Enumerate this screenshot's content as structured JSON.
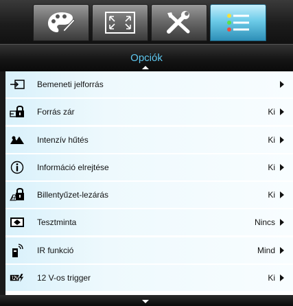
{
  "tabs": [
    {
      "icon": "palette-icon",
      "active": false
    },
    {
      "icon": "screen-resize-icon",
      "active": false
    },
    {
      "icon": "tools-icon",
      "active": false
    },
    {
      "icon": "options-list-icon",
      "active": true
    }
  ],
  "header": {
    "title": "Opciók"
  },
  "menu": {
    "items": [
      {
        "icon": "input-source-icon",
        "label": "Bemeneti jelforrás",
        "value": ""
      },
      {
        "icon": "source-lock-icon",
        "label": "Forrás zár",
        "value": "Ki"
      },
      {
        "icon": "high-cooling-icon",
        "label": "Intenzív hűtés",
        "value": "Ki"
      },
      {
        "icon": "info-icon",
        "label": "Információ elrejtése",
        "value": "Ki"
      },
      {
        "icon": "keypad-lock-icon",
        "label": "Billentyűzet-lezárás",
        "value": "Ki"
      },
      {
        "icon": "test-pattern-icon",
        "label": "Tesztminta",
        "value": "Nincs"
      },
      {
        "icon": "ir-remote-icon",
        "label": "IR funkció",
        "value": "Mind"
      },
      {
        "icon": "trigger-12v-icon",
        "label": "12 V-os trigger",
        "value": "Ki"
      }
    ]
  },
  "colors": {
    "accent": "#5fc8f0",
    "active_tab": "#6ccbe8",
    "row_bg": "#eef9fd"
  }
}
